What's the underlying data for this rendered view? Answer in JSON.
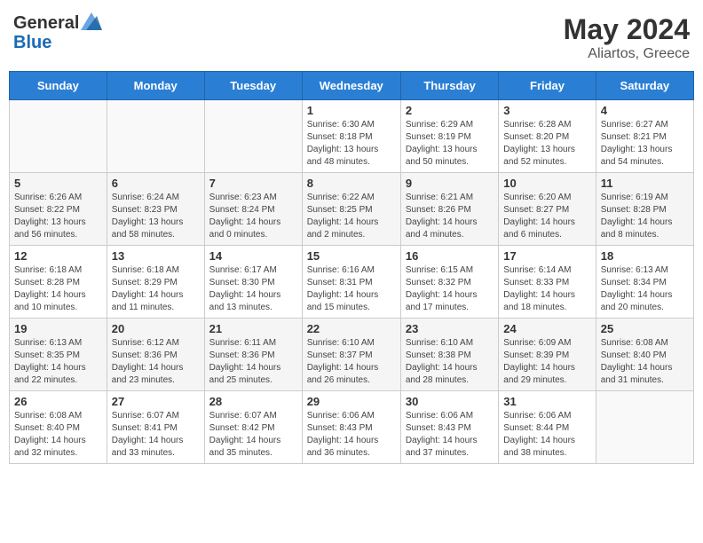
{
  "header": {
    "logo_general": "General",
    "logo_blue": "Blue",
    "month_year": "May 2024",
    "location": "Aliartos, Greece"
  },
  "calendar": {
    "days_of_week": [
      "Sunday",
      "Monday",
      "Tuesday",
      "Wednesday",
      "Thursday",
      "Friday",
      "Saturday"
    ],
    "weeks": [
      [
        {
          "day": "",
          "info": ""
        },
        {
          "day": "",
          "info": ""
        },
        {
          "day": "",
          "info": ""
        },
        {
          "day": "1",
          "info": "Sunrise: 6:30 AM\nSunset: 8:18 PM\nDaylight: 13 hours\nand 48 minutes."
        },
        {
          "day": "2",
          "info": "Sunrise: 6:29 AM\nSunset: 8:19 PM\nDaylight: 13 hours\nand 50 minutes."
        },
        {
          "day": "3",
          "info": "Sunrise: 6:28 AM\nSunset: 8:20 PM\nDaylight: 13 hours\nand 52 minutes."
        },
        {
          "day": "4",
          "info": "Sunrise: 6:27 AM\nSunset: 8:21 PM\nDaylight: 13 hours\nand 54 minutes."
        }
      ],
      [
        {
          "day": "5",
          "info": "Sunrise: 6:26 AM\nSunset: 8:22 PM\nDaylight: 13 hours\nand 56 minutes."
        },
        {
          "day": "6",
          "info": "Sunrise: 6:24 AM\nSunset: 8:23 PM\nDaylight: 13 hours\nand 58 minutes."
        },
        {
          "day": "7",
          "info": "Sunrise: 6:23 AM\nSunset: 8:24 PM\nDaylight: 14 hours\nand 0 minutes."
        },
        {
          "day": "8",
          "info": "Sunrise: 6:22 AM\nSunset: 8:25 PM\nDaylight: 14 hours\nand 2 minutes."
        },
        {
          "day": "9",
          "info": "Sunrise: 6:21 AM\nSunset: 8:26 PM\nDaylight: 14 hours\nand 4 minutes."
        },
        {
          "day": "10",
          "info": "Sunrise: 6:20 AM\nSunset: 8:27 PM\nDaylight: 14 hours\nand 6 minutes."
        },
        {
          "day": "11",
          "info": "Sunrise: 6:19 AM\nSunset: 8:28 PM\nDaylight: 14 hours\nand 8 minutes."
        }
      ],
      [
        {
          "day": "12",
          "info": "Sunrise: 6:18 AM\nSunset: 8:28 PM\nDaylight: 14 hours\nand 10 minutes."
        },
        {
          "day": "13",
          "info": "Sunrise: 6:18 AM\nSunset: 8:29 PM\nDaylight: 14 hours\nand 11 minutes."
        },
        {
          "day": "14",
          "info": "Sunrise: 6:17 AM\nSunset: 8:30 PM\nDaylight: 14 hours\nand 13 minutes."
        },
        {
          "day": "15",
          "info": "Sunrise: 6:16 AM\nSunset: 8:31 PM\nDaylight: 14 hours\nand 15 minutes."
        },
        {
          "day": "16",
          "info": "Sunrise: 6:15 AM\nSunset: 8:32 PM\nDaylight: 14 hours\nand 17 minutes."
        },
        {
          "day": "17",
          "info": "Sunrise: 6:14 AM\nSunset: 8:33 PM\nDaylight: 14 hours\nand 18 minutes."
        },
        {
          "day": "18",
          "info": "Sunrise: 6:13 AM\nSunset: 8:34 PM\nDaylight: 14 hours\nand 20 minutes."
        }
      ],
      [
        {
          "day": "19",
          "info": "Sunrise: 6:13 AM\nSunset: 8:35 PM\nDaylight: 14 hours\nand 22 minutes."
        },
        {
          "day": "20",
          "info": "Sunrise: 6:12 AM\nSunset: 8:36 PM\nDaylight: 14 hours\nand 23 minutes."
        },
        {
          "day": "21",
          "info": "Sunrise: 6:11 AM\nSunset: 8:36 PM\nDaylight: 14 hours\nand 25 minutes."
        },
        {
          "day": "22",
          "info": "Sunrise: 6:10 AM\nSunset: 8:37 PM\nDaylight: 14 hours\nand 26 minutes."
        },
        {
          "day": "23",
          "info": "Sunrise: 6:10 AM\nSunset: 8:38 PM\nDaylight: 14 hours\nand 28 minutes."
        },
        {
          "day": "24",
          "info": "Sunrise: 6:09 AM\nSunset: 8:39 PM\nDaylight: 14 hours\nand 29 minutes."
        },
        {
          "day": "25",
          "info": "Sunrise: 6:08 AM\nSunset: 8:40 PM\nDaylight: 14 hours\nand 31 minutes."
        }
      ],
      [
        {
          "day": "26",
          "info": "Sunrise: 6:08 AM\nSunset: 8:40 PM\nDaylight: 14 hours\nand 32 minutes."
        },
        {
          "day": "27",
          "info": "Sunrise: 6:07 AM\nSunset: 8:41 PM\nDaylight: 14 hours\nand 33 minutes."
        },
        {
          "day": "28",
          "info": "Sunrise: 6:07 AM\nSunset: 8:42 PM\nDaylight: 14 hours\nand 35 minutes."
        },
        {
          "day": "29",
          "info": "Sunrise: 6:06 AM\nSunset: 8:43 PM\nDaylight: 14 hours\nand 36 minutes."
        },
        {
          "day": "30",
          "info": "Sunrise: 6:06 AM\nSunset: 8:43 PM\nDaylight: 14 hours\nand 37 minutes."
        },
        {
          "day": "31",
          "info": "Sunrise: 6:06 AM\nSunset: 8:44 PM\nDaylight: 14 hours\nand 38 minutes."
        },
        {
          "day": "",
          "info": ""
        }
      ]
    ]
  }
}
